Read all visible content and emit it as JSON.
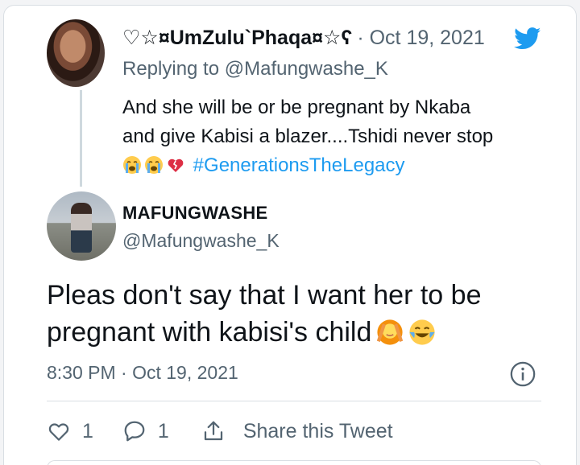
{
  "reply_tweet": {
    "display_name": "♡☆¤UmZulu`Phaqa¤☆ʕ",
    "meta": "· Oct 19, 2021",
    "replying_prefix": "Replying to",
    "replying_handle": "@Mafungwashe_K",
    "text_line1": "And she will be or be pregnant by Nkaba",
    "text_line2": "and give Kabisi a blazer....Tshidi never stop",
    "hashtag": "#GenerationsTheLegacy",
    "emojis": [
      "loudly-crying-face",
      "loudly-crying-face",
      "broken-heart"
    ]
  },
  "main_tweet": {
    "display_name": "MAFUNGWASHE",
    "handle": "@Mafungwashe_K",
    "text_line1": "Pleas don't say that I want her to be",
    "text_line2": "pregnant with kabisi's child",
    "emojis": [
      "person-gesturing-no",
      "face-with-tears-of-joy"
    ],
    "timestamp": "8:30 PM · Oct 19, 2021"
  },
  "actions": {
    "like_count": "1",
    "reply_count": "1",
    "share_label": "Share this Tweet"
  },
  "colors": {
    "twitter_blue": "#1d9bf0",
    "secondary_text": "#536471",
    "primary_text": "#0f1419"
  }
}
